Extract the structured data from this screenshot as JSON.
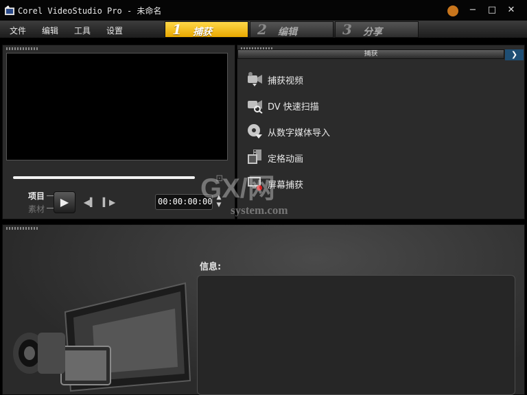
{
  "window": {
    "title": "Corel VideoStudio Pro - 未命名",
    "minimize": "−",
    "maximize": "□",
    "close": "✕"
  },
  "menu": {
    "items": [
      "文件",
      "编辑",
      "工具",
      "设置"
    ]
  },
  "steps": [
    {
      "number": "1",
      "label": "捕获",
      "active": true
    },
    {
      "number": "2",
      "label": "编辑",
      "active": false
    },
    {
      "number": "3",
      "label": "分享",
      "active": false
    }
  ],
  "player": {
    "mode_project": "项目",
    "mode_clip": "素材",
    "play_icon": "▶",
    "prev_frame_icon": "◀▍",
    "next_frame_icon": "▍▶",
    "resize_icon": "⊡",
    "timecode": "00:00:00:00",
    "spin_up": "▲",
    "spin_down": "▼"
  },
  "capture_panel": {
    "header": "捕获",
    "collapse_icon": "❯",
    "options": [
      {
        "label": "捕获视频",
        "icon": "video-camera-icon"
      },
      {
        "label": "DV 快速扫描",
        "icon": "dv-scan-icon"
      },
      {
        "label": "从数字媒体导入",
        "icon": "disc-import-icon"
      },
      {
        "label": "定格动画",
        "icon": "stop-motion-icon"
      },
      {
        "label": "屏幕捕获",
        "icon": "screen-capture-icon"
      }
    ]
  },
  "watermark": {
    "text_big": "GX/网",
    "text_small": "system.com"
  },
  "info": {
    "label": "信息:"
  },
  "colors": {
    "accent": "#f5c21b",
    "panel_bg": "#2b2b2b",
    "preview_bg": "#000000",
    "collapse_btn": "#1e4e74"
  }
}
